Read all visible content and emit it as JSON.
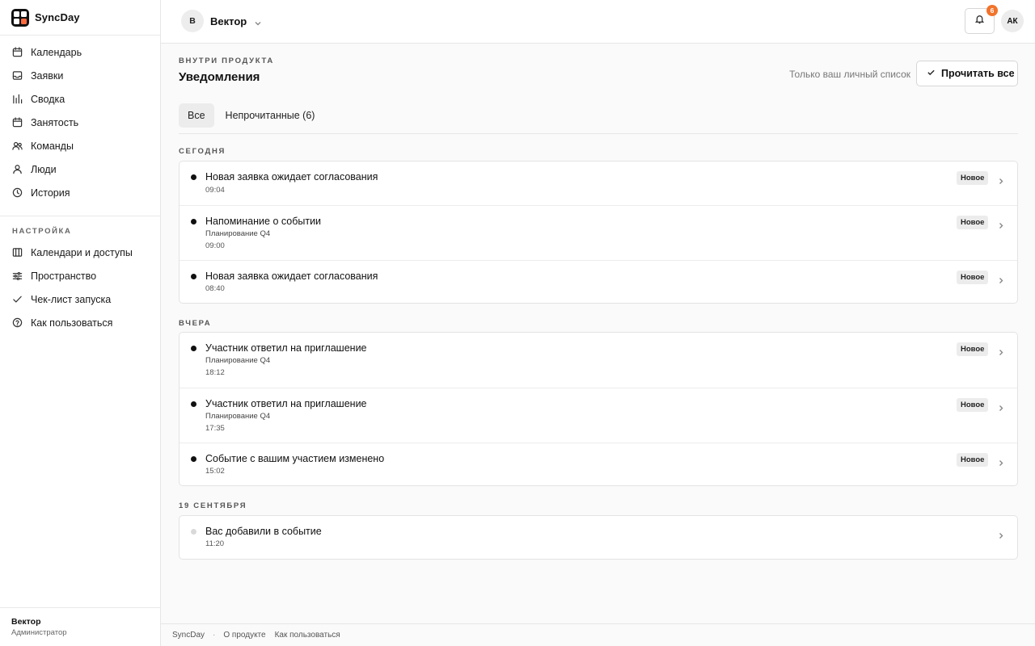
{
  "app": {
    "name": "SyncDay"
  },
  "sidebar": {
    "items": [
      {
        "label": "Календарь",
        "icon": "calendar-icon"
      },
      {
        "label": "Заявки",
        "icon": "inbox-icon"
      },
      {
        "label": "Сводка",
        "icon": "bar-chart-icon"
      },
      {
        "label": "Занятость",
        "icon": "calendar-icon"
      },
      {
        "label": "Команды",
        "icon": "users-icon"
      },
      {
        "label": "Люди",
        "icon": "user-icon"
      },
      {
        "label": "История",
        "icon": "clock-icon"
      }
    ],
    "settings_label": "НАСТРОЙКА",
    "settings_items": [
      {
        "label": "Календари и доступы",
        "icon": "book-icon"
      },
      {
        "label": "Пространство",
        "icon": "sliders-icon"
      },
      {
        "label": "Чек-лист запуска",
        "icon": "check-icon"
      },
      {
        "label": "Как пользоваться",
        "icon": "help-circle-icon"
      }
    ],
    "footer": {
      "workspace": "Вектор",
      "role": "Администратор"
    }
  },
  "topbar": {
    "workspace_initial": "В",
    "workspace_name": "Вектор",
    "notifications_count": "6",
    "user_initials": "АК"
  },
  "page": {
    "eyebrow": "ВНУТРИ ПРОДУКТА",
    "title": "Уведомления",
    "scope_note": "Только ваш личный список",
    "read_all_label": "Прочитать все"
  },
  "tabs": [
    {
      "label": "Все",
      "active": true
    },
    {
      "label": "Непрочитанные (6)",
      "active": false
    }
  ],
  "groups": [
    {
      "label": "СЕГОДНЯ",
      "items": [
        {
          "title": "Новая заявка ожидает согласования",
          "subtitle": "",
          "time": "09:04",
          "badge": "Новое",
          "unread": true
        },
        {
          "title": "Напоминание о событии",
          "subtitle": "Планирование Q4",
          "time": "09:00",
          "badge": "Новое",
          "unread": true
        },
        {
          "title": "Новая заявка ожидает согласования",
          "subtitle": "",
          "time": "08:40",
          "badge": "Новое",
          "unread": true
        }
      ]
    },
    {
      "label": "ВЧЕРА",
      "items": [
        {
          "title": "Участник ответил на приглашение",
          "subtitle": "Планирование Q4",
          "time": "18:12",
          "badge": "Новое",
          "unread": true
        },
        {
          "title": "Участник ответил на приглашение",
          "subtitle": "Планирование Q4",
          "time": "17:35",
          "badge": "Новое",
          "unread": true
        },
        {
          "title": "Событие с вашим участием изменено",
          "subtitle": "",
          "time": "15:02",
          "badge": "Новое",
          "unread": true
        }
      ]
    },
    {
      "label": "19 СЕНТЯБРЯ",
      "items": [
        {
          "title": "Вас добавили в событие",
          "subtitle": "",
          "time": "11:20",
          "badge": "",
          "unread": false
        }
      ]
    }
  ],
  "footer": {
    "brand": "SyncDay",
    "links": [
      "О продукте",
      "Как пользоваться"
    ]
  },
  "colors": {
    "accent_badge": "#f2732b",
    "unread_dot": "#111111",
    "read_dot": "#d9d9d9"
  }
}
